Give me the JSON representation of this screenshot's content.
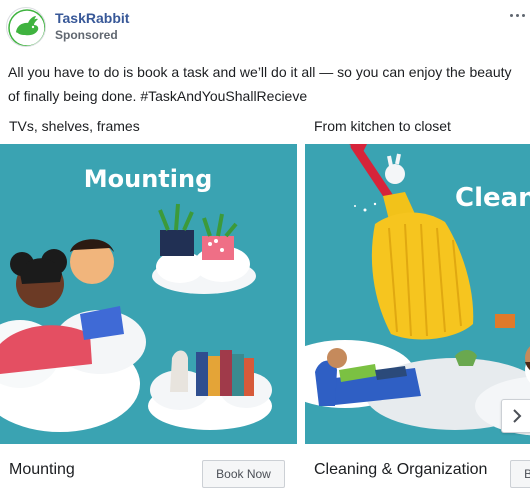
{
  "post": {
    "page_name": "TaskRabbit",
    "sponsored_label": "Sponsored",
    "caption": "All you have to do is book a task and we’ll do it all — so you can enjoy the beauty\nof finally being done. #TaskAndYouShallRecieve",
    "more_icon": "more-horizontal-icon",
    "avatar_icon": "rabbit-logo-icon",
    "colors": {
      "brand_green": "#3fb33f",
      "link_blue": "#385898",
      "image_teal": "#3aa3b2"
    }
  },
  "carousel": {
    "cards": [
      {
        "headline": "TVs, shelves, frames",
        "image_text": "Mounting",
        "title": "Mounting",
        "cta": "Book Now"
      },
      {
        "headline": "From kitchen to closet",
        "image_text": "Clean",
        "title": "Cleaning & Organization",
        "cta": "Book Now"
      }
    ],
    "next_icon": "chevron-right-icon"
  }
}
